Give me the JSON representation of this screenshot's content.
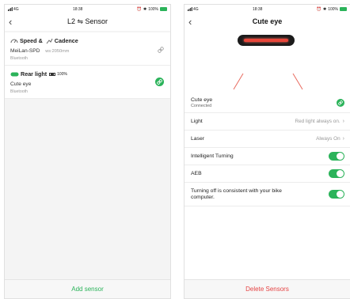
{
  "left": {
    "status": {
      "signal": "4G",
      "time": "18:38",
      "battery": "100%"
    },
    "title": "L2 ⇋ Sensor",
    "speed_cadence": {
      "title_speed": "Speed &",
      "title_cadence": "Cadence",
      "device": "MeiLan-SPD",
      "ws": "ws:2050mm",
      "connection": "Bluetooth",
      "icons": [
        "speedometer-icon",
        "cadence-icon",
        "link-icon"
      ]
    },
    "rear_light": {
      "title": "Rear light",
      "battery": "100%",
      "device": "Cute eye",
      "connection": "Bluetooth",
      "icons": [
        "rear-light-icon",
        "battery-icon",
        "link-icon"
      ]
    },
    "add_sensor": "Add sensor"
  },
  "right": {
    "status": {
      "signal": "4G",
      "time": "18:38",
      "battery": "100%"
    },
    "title": "Cute eye",
    "device": {
      "name": "Cute eye",
      "status": "Connected"
    },
    "rows": {
      "light": {
        "label": "Light",
        "value": "Red light always on."
      },
      "laser": {
        "label": "Laser",
        "value": "Always On"
      }
    },
    "toggles": {
      "intelligent_turning": {
        "label": "Intelligent Turning",
        "on": true
      },
      "aeb": {
        "label": "AEB",
        "on": true
      },
      "turning_off": {
        "label": "Turning off is consistent with your bike computer.",
        "on": true
      }
    },
    "delete_sensors": "Delete Sensors"
  },
  "colors": {
    "accent_green": "#2bb35a",
    "danger_red": "#e54343",
    "light_red": "#e8463a"
  }
}
